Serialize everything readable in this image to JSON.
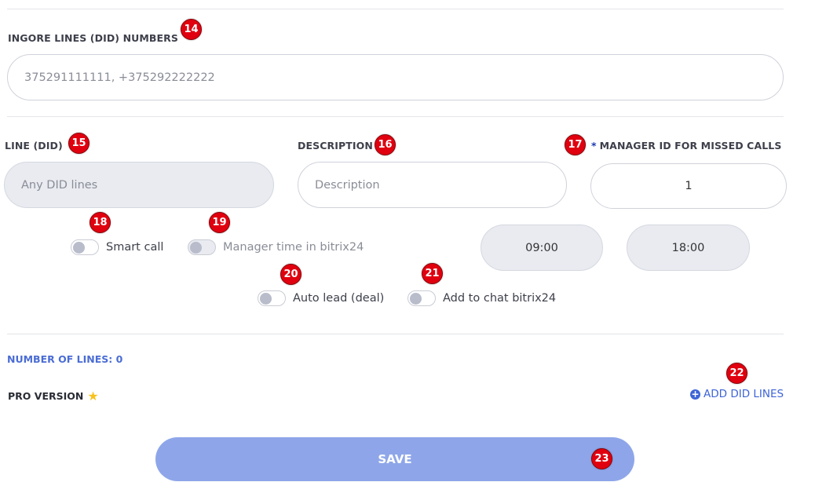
{
  "ignore_lines": {
    "label": "INGORE LINES (DID) NUMBERS",
    "placeholder": "375291111111, +375292222222"
  },
  "line_did": {
    "label": "LINE (DID)",
    "placeholder": "Any DID lines"
  },
  "description": {
    "label": "DESCRIPTION",
    "placeholder": "Description"
  },
  "manager_id": {
    "required_mark": "*",
    "label": "MANAGER ID FOR MISSED CALLS",
    "value": "1"
  },
  "time": {
    "start": "09:00",
    "end": "18:00"
  },
  "toggles": {
    "smart_call": "Smart call",
    "manager_time": "Manager time in bitrix24",
    "auto_lead": "Auto lead (deal)",
    "add_to_chat": "Add to chat bitrix24"
  },
  "footer": {
    "number_of_lines": "NUMBER OF LINES: 0",
    "pro_version": "PRO VERSION",
    "add_did_lines": "ADD DID LINES",
    "save": "SAVE"
  },
  "badges": [
    "14",
    "15",
    "16",
    "17",
    "18",
    "19",
    "20",
    "21",
    "22",
    "23"
  ],
  "colors": {
    "accent": "#4a6cd4",
    "save_button": "#8ea6e9",
    "badge": "#e0000f",
    "star": "#f7c21b"
  }
}
